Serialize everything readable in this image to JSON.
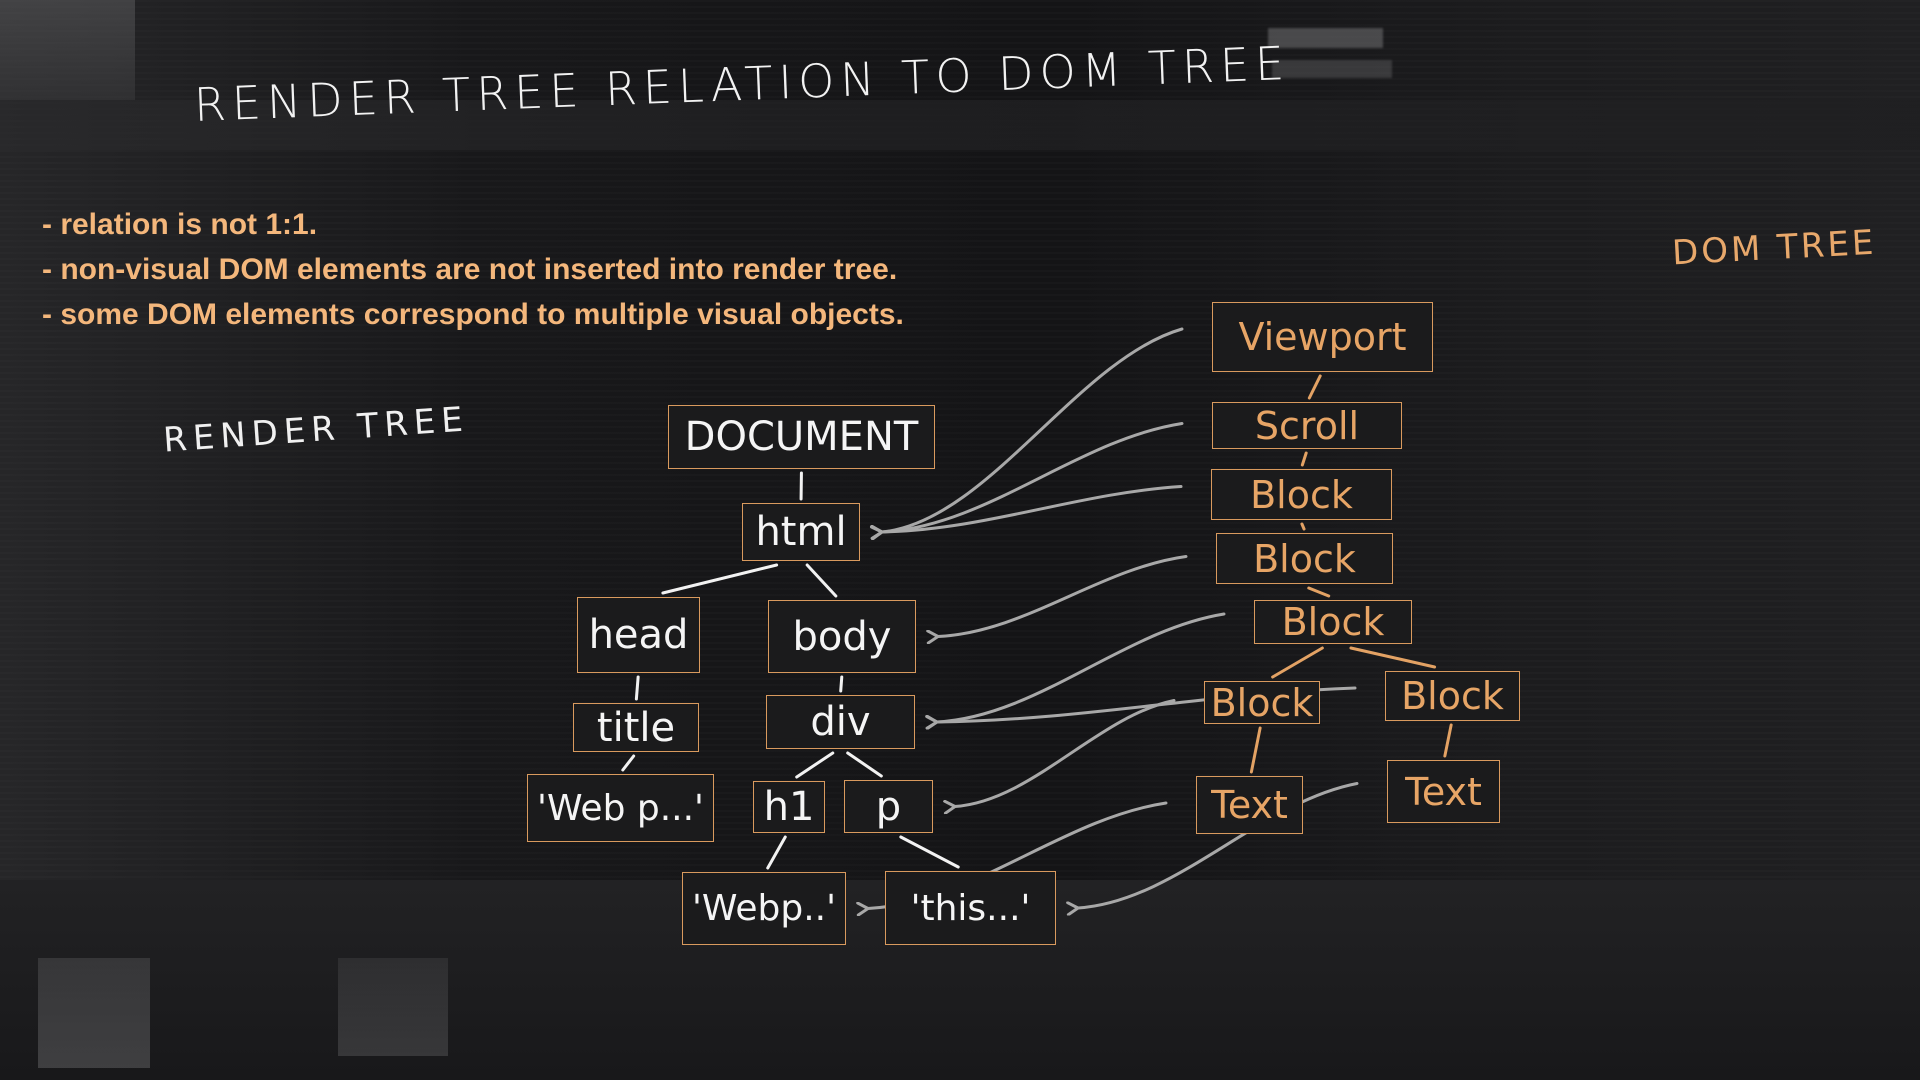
{
  "title": "RENDER TREE RELATION TO DOM TREE",
  "bullets": [
    "- relation is not 1:1.",
    "- non-visual DOM elements are not inserted into render tree.",
    "- some DOM elements correspond to multiple visual objects."
  ],
  "labels": {
    "left_tree": "RENDER TREE",
    "right_tree": "DOM TREE"
  },
  "colors": {
    "background": "#1a1a1b",
    "bullet_text": "#f4b77c",
    "box_border": "#d99a5e",
    "left_tree_text": "#f5f5f5",
    "right_tree_text": "#e7a566",
    "arrow": "#a8a8a8"
  },
  "left_tree": {
    "nodes": [
      {
        "id": "document",
        "label": "DOCUMENT"
      },
      {
        "id": "html",
        "label": "html"
      },
      {
        "id": "head",
        "label": "head"
      },
      {
        "id": "body",
        "label": "body"
      },
      {
        "id": "title",
        "label": "title"
      },
      {
        "id": "div",
        "label": "div"
      },
      {
        "id": "title_text",
        "label": "'Web p...'"
      },
      {
        "id": "h1",
        "label": "h1"
      },
      {
        "id": "p",
        "label": "p"
      },
      {
        "id": "h1_text",
        "label": "'Webp..'"
      },
      {
        "id": "p_text",
        "label": "'this...'"
      }
    ],
    "edges": [
      [
        "document",
        "html"
      ],
      [
        "html",
        "head"
      ],
      [
        "html",
        "body"
      ],
      [
        "head",
        "title"
      ],
      [
        "title",
        "title_text"
      ],
      [
        "body",
        "div"
      ],
      [
        "div",
        "h1"
      ],
      [
        "div",
        "p"
      ],
      [
        "h1",
        "h1_text"
      ],
      [
        "p",
        "p_text"
      ]
    ]
  },
  "right_tree": {
    "nodes": [
      {
        "id": "viewport",
        "label": "Viewport"
      },
      {
        "id": "scroll",
        "label": "Scroll"
      },
      {
        "id": "block1",
        "label": "Block"
      },
      {
        "id": "block2",
        "label": "Block"
      },
      {
        "id": "block3",
        "label": "Block"
      },
      {
        "id": "block4",
        "label": "Block"
      },
      {
        "id": "block5",
        "label": "Block"
      },
      {
        "id": "text1",
        "label": "Text"
      },
      {
        "id": "text2",
        "label": "Text"
      }
    ],
    "edges": [
      [
        "viewport",
        "scroll"
      ],
      [
        "scroll",
        "block1"
      ],
      [
        "block1",
        "block2"
      ],
      [
        "block2",
        "block3"
      ],
      [
        "block3",
        "block4"
      ],
      [
        "block3",
        "block5"
      ],
      [
        "block4",
        "text1"
      ],
      [
        "block5",
        "text2"
      ]
    ]
  },
  "mappings": [
    {
      "from": "viewport",
      "to": "html"
    },
    {
      "from": "scroll",
      "to": "html"
    },
    {
      "from": "block1",
      "to": "html"
    },
    {
      "from": "block2",
      "to": "body"
    },
    {
      "from": "block3",
      "to": "div"
    },
    {
      "from": "block4",
      "to": "p"
    },
    {
      "from": "block5",
      "to": "div"
    },
    {
      "from": "text1",
      "to": "h1_text"
    },
    {
      "from": "text2",
      "to": "p_text"
    }
  ]
}
